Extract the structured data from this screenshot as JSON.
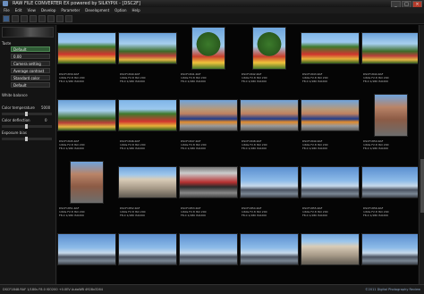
{
  "window": {
    "title": "RAW FILE CONVERTER EX powered by SILKYPIX - [DSC2F]"
  },
  "menu": [
    "File",
    "Edit",
    "View",
    "Develop",
    "Parameter",
    "Development",
    "Option",
    "Help"
  ],
  "left_panel": {
    "taste": "Taste",
    "image_labels": [
      "Default",
      "Camera setting",
      "Average contrast",
      "Standard color",
      "Default"
    ],
    "wb_label": "White balance",
    "color_temp_label": "Color temperature",
    "color_temp_value": "5000",
    "tint_label": "Color deflection",
    "tint_value": "0",
    "exposure_label": "Exposure bias",
    "exposure_value": "0.00"
  },
  "thumbnails": [
    {
      "name": "DSCF1839.RAF",
      "line2": "1/60s F2.8 ISO 200",
      "line3": "F8.0 1/180 ISO200",
      "photo": "tulip",
      "shape": "wide"
    },
    {
      "name": "DSCF1840.RAF",
      "line2": "1/60s F2.8 ISO 200",
      "line3": "F8.0 1/180 ISO200",
      "photo": "park",
      "shape": "wide"
    },
    {
      "name": "DSCF1841.RAF",
      "line2": "1/60s F2.8 ISO 200",
      "line3": "F8.0 1/180 ISO200",
      "photo": "tree",
      "shape": "tall"
    },
    {
      "name": "DSCF1842.RAF",
      "line2": "1/60s F2.8 ISO 200",
      "line3": "F8.0 1/180 ISO200",
      "photo": "tree",
      "shape": "tall"
    },
    {
      "name": "DSCF1843.RAF",
      "line2": "1/60s F2.8 ISO 200",
      "line3": "F8.0 1/180 ISO200",
      "photo": "tulip",
      "shape": "wide"
    },
    {
      "name": "DSCF1844.RAF",
      "line2": "1/60s F2.8 ISO 200",
      "line3": "F8.0 1/180 ISO200",
      "photo": "park",
      "shape": "wide"
    },
    {
      "name": "DSCF1845.RAF",
      "line2": "1/60s F2.8 ISO 200",
      "line3": "F8.0 1/180 ISO200",
      "photo": "park",
      "shape": "wide"
    },
    {
      "name": "DSCF1846.RAF",
      "line2": "1/60s F2.8 ISO 200",
      "line3": "F8.0 1/180 ISO200",
      "photo": "tulip",
      "shape": "wide"
    },
    {
      "name": "DSCF1847.RAF",
      "line2": "1/60s F2.8 ISO 200",
      "line3": "F8.0 1/180 ISO200",
      "photo": "car",
      "shape": "wide"
    },
    {
      "name": "DSCF1848.RAF",
      "line2": "1/60s F2.8 ISO 200",
      "line3": "F8.0 1/180 ISO200",
      "photo": "car",
      "shape": "wide"
    },
    {
      "name": "DSCF1849.RAF",
      "line2": "1/60s F2.8 ISO 200",
      "line3": "F8.0 1/180 ISO200",
      "photo": "car",
      "shape": "wide"
    },
    {
      "name": "DSCF1850.RAF",
      "line2": "1/60s F2.8 ISO 200",
      "line3": "F8.0 1/180 ISO200",
      "photo": "bldg2",
      "shape": "tall"
    },
    {
      "name": "DSCF1851.RAF",
      "line2": "1/60s F2.8 ISO 200",
      "line3": "F8.0 1/180 ISO200",
      "photo": "bldg2",
      "shape": "tall"
    },
    {
      "name": "DSCF1852.RAF",
      "line2": "1/60s F2.8 ISO 200",
      "line3": "F8.0 1/180 ISO200",
      "photo": "building",
      "shape": "wide"
    },
    {
      "name": "DSCF1853.RAF",
      "line2": "1/60s F2.8 ISO 200",
      "line3": "F8.0 1/180 ISO200",
      "photo": "train",
      "shape": "wide"
    },
    {
      "name": "DSCF1854.RAF",
      "line2": "1/60s F2.8 ISO 200",
      "line3": "F8.0 1/180 ISO200",
      "photo": "city",
      "shape": "wide"
    },
    {
      "name": "DSCF1855.RAF",
      "line2": "1/60s F2.8 ISO 200",
      "line3": "F8.0 1/180 ISO200",
      "photo": "city",
      "shape": "wide"
    },
    {
      "name": "DSCF1856.RAF",
      "line2": "1/60s F2.8 ISO 200",
      "line3": "F8.0 1/180 ISO200",
      "photo": "city",
      "shape": "wide"
    },
    {
      "name": "",
      "line2": "",
      "line3": "",
      "photo": "city",
      "shape": "wide"
    },
    {
      "name": "",
      "line2": "",
      "line3": "",
      "photo": "city",
      "shape": "wide"
    },
    {
      "name": "",
      "line2": "",
      "line3": "",
      "photo": "city",
      "shape": "wide"
    },
    {
      "name": "",
      "line2": "",
      "line3": "",
      "photo": "city",
      "shape": "wide"
    },
    {
      "name": "",
      "line2": "",
      "line3": "",
      "photo": "building",
      "shape": "wide"
    },
    {
      "name": "",
      "line2": "",
      "line3": "",
      "photo": "city",
      "shape": "wide"
    }
  ],
  "status": {
    "left": "DSCF1848.RAF 1/180s F8.0 ISO200 +0.0EV AutoWB 4928x3264",
    "right": "©2011 Digital Photography Review"
  }
}
